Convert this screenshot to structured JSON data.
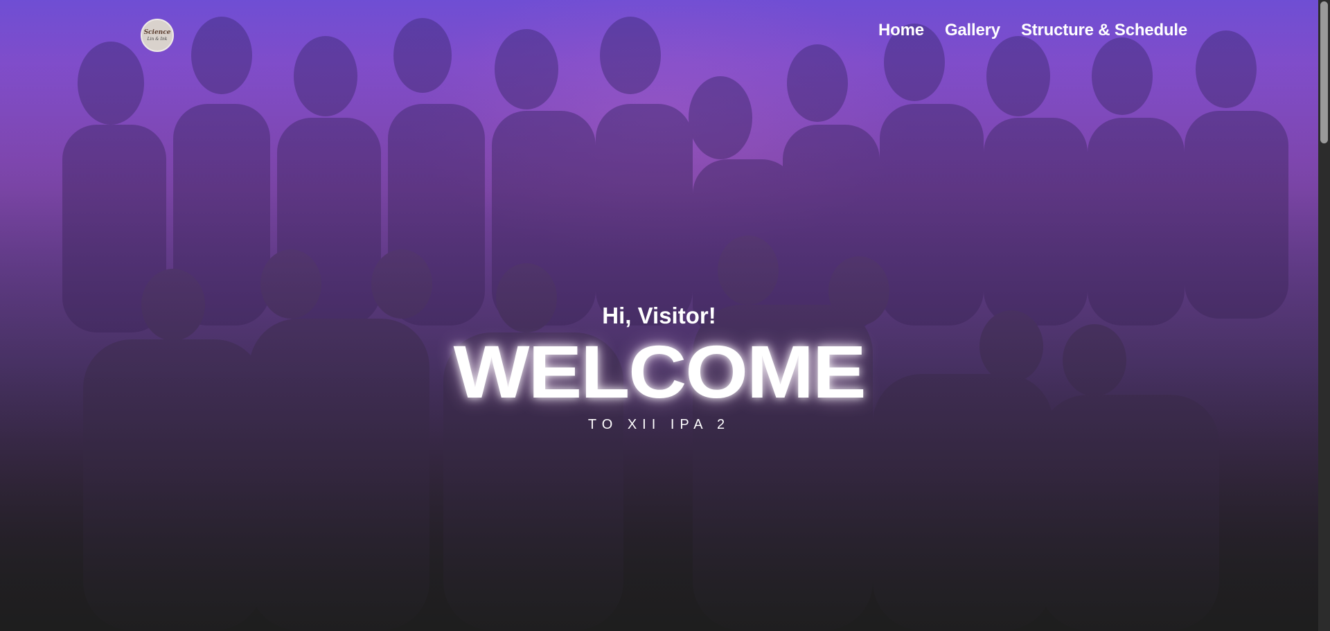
{
  "brand": {
    "logo_text": "Science",
    "logo_sub": "Lin & Ink"
  },
  "nav": {
    "items": [
      {
        "label": "Home"
      },
      {
        "label": "Gallery"
      },
      {
        "label": "Structure & Schedule"
      }
    ]
  },
  "hero": {
    "greeting": "Hi, Visitor!",
    "headline": "WELCOME",
    "subline": "TO XII IPA 2"
  },
  "colors": {
    "overlay_top": "#7a52cf",
    "overlay_bottom": "#1f1f1f",
    "text": "#ffffff"
  }
}
